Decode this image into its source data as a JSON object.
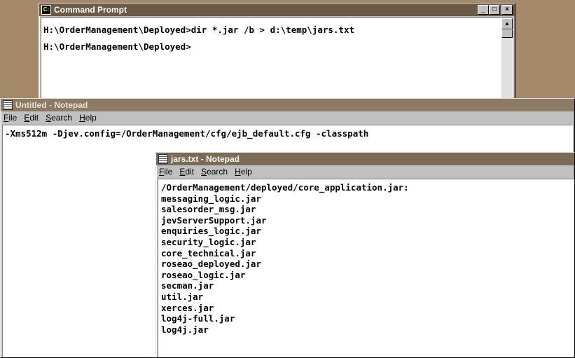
{
  "cmd": {
    "title": "Command Prompt",
    "lines": [
      "H:\\OrderManagement\\Deployed>dir *.jar /b > d:\\temp\\jars.txt",
      "H:\\OrderManagement\\Deployed>"
    ],
    "buttons": {
      "minimize": "_",
      "maximize": "□",
      "close": "×"
    }
  },
  "notepad_untitled": {
    "title": "Untitled - Notepad",
    "menu": [
      "File",
      "Edit",
      "Search",
      "Help"
    ],
    "content": "-Xms512m -Djev.config=/OrderManagement/cfg/ejb_default.cfg -classpath"
  },
  "notepad_jars": {
    "title": "jars.txt - Notepad",
    "menu": [
      "File",
      "Edit",
      "Search",
      "Help"
    ],
    "lines": [
      "/OrderManagement/deployed/core_application.jar:",
      "messaging_logic.jar",
      "salesorder_msg.jar",
      "jevServerSupport.jar",
      "enquiries_logic.jar",
      "security_logic.jar",
      "core_technical.jar",
      "roseao_deployed.jar",
      "roseao_logic.jar",
      "secman.jar",
      "util.jar",
      "xerces.jar",
      "log4j-full.jar",
      "log4j.jar"
    ]
  },
  "colors": {
    "desktop": "#a48a6a",
    "titlebar": "#7b6a55"
  },
  "icons": {
    "cmd": "ms-dos-icon",
    "notepad": "notepad-icon"
  }
}
